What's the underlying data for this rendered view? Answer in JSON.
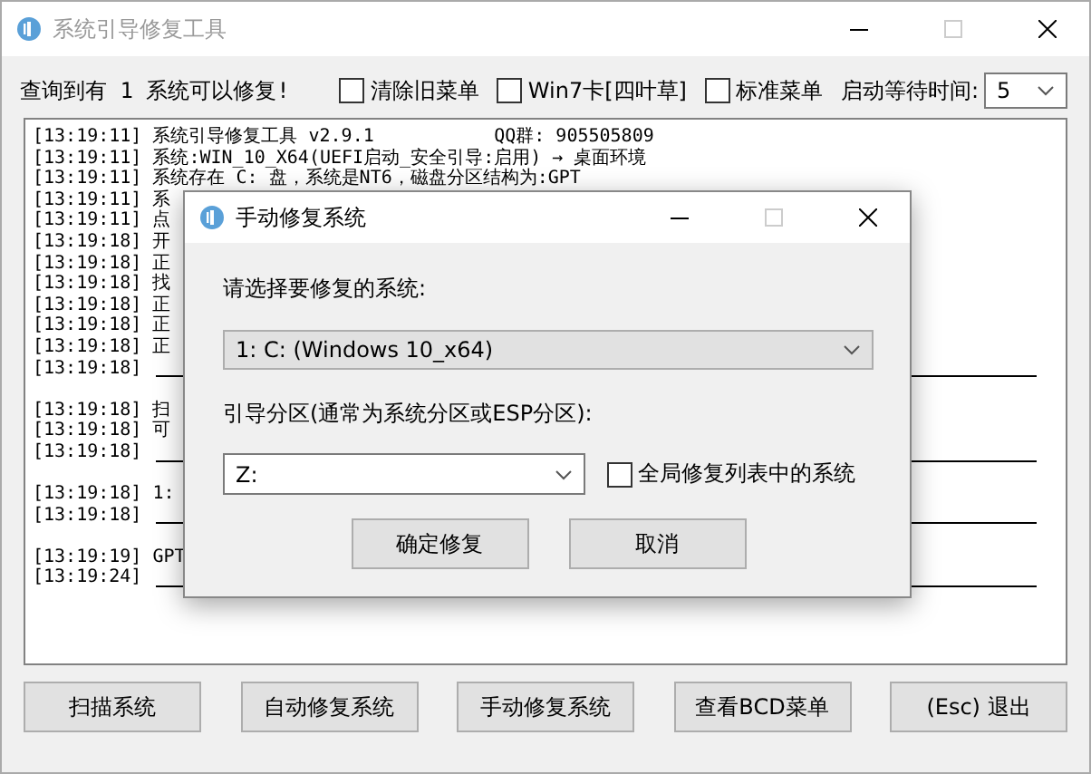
{
  "window": {
    "title": "系统引导修复工具"
  },
  "toolbar": {
    "status": "查询到有 1 系统可以修复!",
    "options": [
      {
        "label": "清除旧菜单",
        "checked": false
      },
      {
        "label": "Win7卡[四叶草]",
        "checked": false
      },
      {
        "label": "标准菜单",
        "checked": false
      }
    ],
    "timeout_label": "启动等待时间:",
    "timeout_value": "5"
  },
  "log": [
    {
      "kind": "text",
      "time": "[13:19:11]",
      "text": "系统引导修复工具 v2.9.1           QQ群: 905505809"
    },
    {
      "kind": "text",
      "time": "[13:19:11]",
      "text": "系统:WIN_10_X64(UEFI启动_安全引导:启用) → 桌面环境"
    },
    {
      "kind": "text",
      "time": "[13:19:11]",
      "text": "系统存在 C: 盘，系统是NT6，磁盘分区结构为:GPT"
    },
    {
      "kind": "text",
      "time": "[13:19:11]",
      "text": "系"
    },
    {
      "kind": "text",
      "time": "[13:19:11]",
      "text": "点"
    },
    {
      "kind": "text",
      "time": "[13:19:18]",
      "text": "开"
    },
    {
      "kind": "text",
      "time": "[13:19:18]",
      "text": "正"
    },
    {
      "kind": "text",
      "time": "[13:19:18]",
      "text": "找"
    },
    {
      "kind": "text",
      "time": "[13:19:18]",
      "text": "正"
    },
    {
      "kind": "text",
      "time": "[13:19:18]",
      "text": "正"
    },
    {
      "kind": "text",
      "time": "[13:19:18]",
      "text": "正"
    },
    {
      "kind": "rule",
      "time": "[13:19:18]"
    },
    {
      "kind": "blank"
    },
    {
      "kind": "text",
      "time": "[13:19:18]",
      "text": "扫"
    },
    {
      "kind": "text",
      "time": "[13:19:18]",
      "text": "可"
    },
    {
      "kind": "rule",
      "time": "[13:19:18]"
    },
    {
      "kind": "blank"
    },
    {
      "kind": "text",
      "time": "[13:19:18]",
      "text": "1:"
    },
    {
      "kind": "rule",
      "time": "[13:19:18]"
    },
    {
      "kind": "blank"
    },
    {
      "kind": "text",
      "time": "[13:19:19]",
      "text": "GPT"
    },
    {
      "kind": "rule",
      "time": "[13:19:24]"
    }
  ],
  "buttons": [
    "扫描系统",
    "自动修复系统",
    "手动修复系统",
    "查看BCD菜单",
    "(Esc) 退出"
  ],
  "dialog": {
    "title": "手动修复系统",
    "system_label": "请选择要修复的系统:",
    "system_value": "1: C: (Windows 10_x64)",
    "partition_label": "引导分区(通常为系统分区或ESP分区):",
    "partition_value": "Z:",
    "global_option": {
      "label": "全局修复列表中的系统",
      "checked": false
    },
    "buttons": [
      "确定修复",
      "取消"
    ]
  }
}
